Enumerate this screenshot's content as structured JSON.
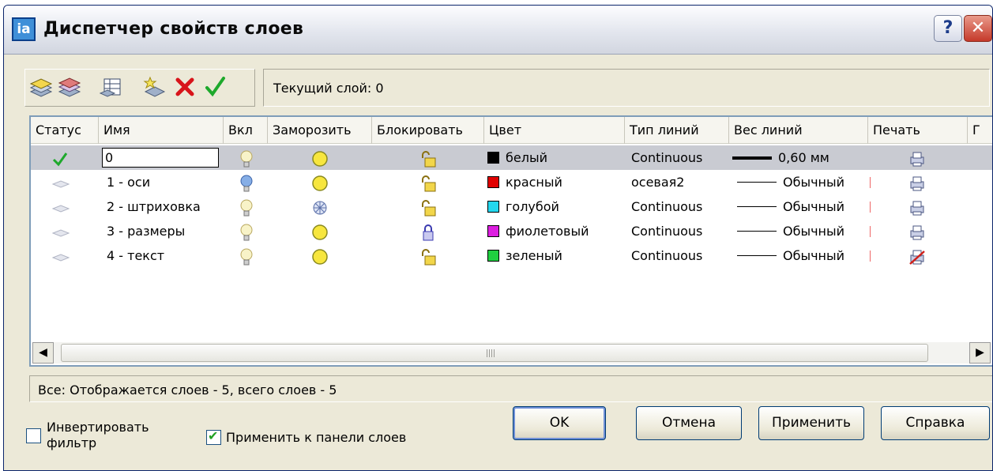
{
  "window": {
    "title": "Диспетчер свойств слоев",
    "help_label": "?",
    "close_label": "✕",
    "app_icon_label": "ia"
  },
  "toolbar": {
    "current_layer_text": "Текущий слой: 0"
  },
  "columns": [
    "Статус",
    "Имя",
    "Вкл",
    "Заморозить",
    "Блокировать",
    "Цвет",
    "Тип линий",
    "Вес линий",
    "Печать",
    "Г"
  ],
  "layers": [
    {
      "name": "0",
      "on": "on-dim",
      "frozen": false,
      "locked": false,
      "color_name": "белый",
      "color": "#000000",
      "linetype": "Continuous",
      "lineweight": "0,60 мм",
      "plot": true,
      "current": true
    },
    {
      "name": "1 - оси",
      "on": "on",
      "frozen": false,
      "locked": false,
      "color_name": "красный",
      "color": "#e00000",
      "linetype": "осевая2",
      "lineweight": "Обычный",
      "plot": true,
      "current": false
    },
    {
      "name": "2 - штриховка",
      "on": "on-dim",
      "frozen": true,
      "locked": false,
      "color_name": "голубой",
      "color": "#24d7ee",
      "linetype": "Continuous",
      "lineweight": "Обычный",
      "plot": true,
      "current": false
    },
    {
      "name": "3 - размеры",
      "on": "on-dim",
      "frozen": false,
      "locked": true,
      "color_name": "фиолетовый",
      "color": "#dc1ee0",
      "linetype": "Continuous",
      "lineweight": "Обычный",
      "plot": true,
      "current": false
    },
    {
      "name": "4 - текст",
      "on": "on-dim",
      "frozen": false,
      "locked": false,
      "color_name": "зеленый",
      "color": "#20d040",
      "linetype": "Continuous",
      "lineweight": "Обычный",
      "plot": false,
      "current": false
    }
  ],
  "status_text": "Все: Отображается слоев - 5, всего слоев - 5",
  "options": {
    "invert_filter": "Инвертировать\nфильтр",
    "invert_checked": false,
    "apply_to_toolbar": "Применить к панели слоев",
    "apply_checked": true
  },
  "buttons": {
    "ok": "OK",
    "cancel": "Отмена",
    "apply": "Применить",
    "help": "Справка"
  }
}
